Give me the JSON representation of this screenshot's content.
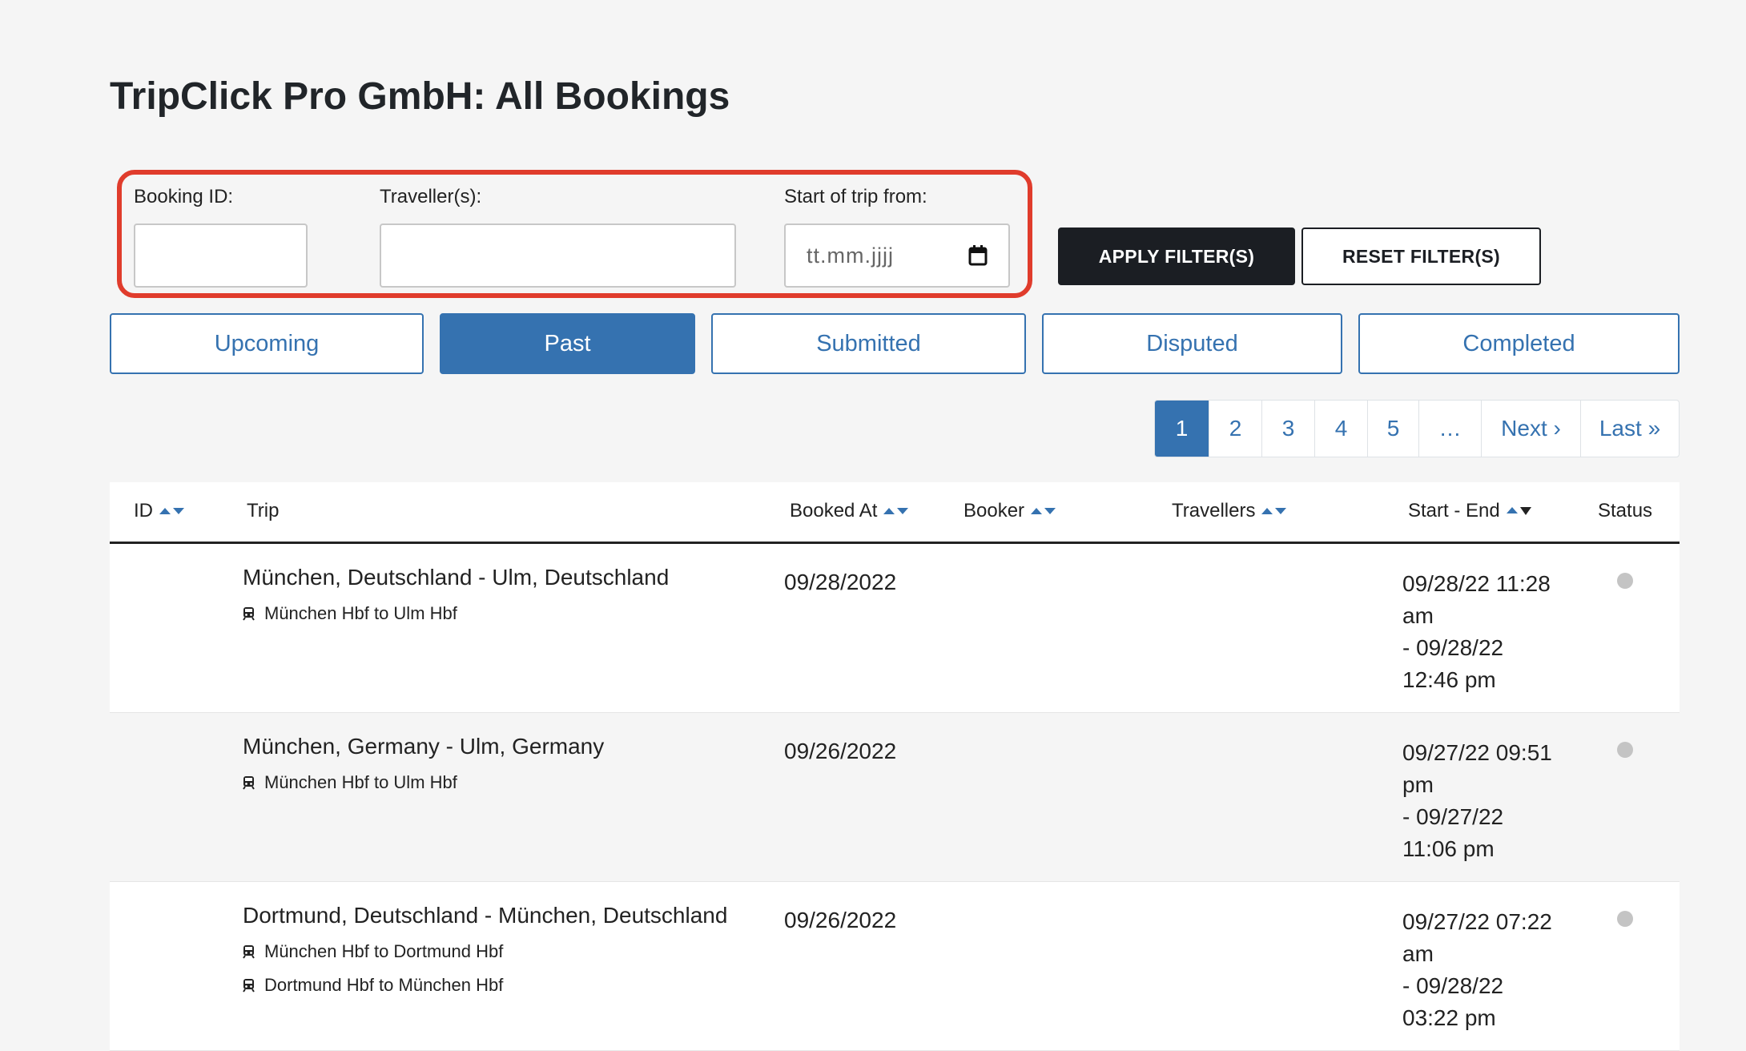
{
  "page": {
    "title": "TripClick Pro GmbH: All Bookings"
  },
  "filters": {
    "booking_id_label": "Booking ID:",
    "travellers_label": "Traveller(s):",
    "start_label": "Start of trip from:",
    "date_placeholder": "tt.mm.jjjj",
    "apply_label": "APPLY FILTER(S)",
    "reset_label": "RESET FILTER(S)"
  },
  "tabs": [
    {
      "label": "Upcoming",
      "active": false
    },
    {
      "label": "Past",
      "active": true
    },
    {
      "label": "Submitted",
      "active": false
    },
    {
      "label": "Disputed",
      "active": false
    },
    {
      "label": "Completed",
      "active": false
    }
  ],
  "pagination": {
    "pages": [
      "1",
      "2",
      "3",
      "4",
      "5",
      "…"
    ],
    "current": "1",
    "next_label": "Next ›",
    "last_label": "Last »"
  },
  "table": {
    "headers": {
      "id": "ID",
      "trip": "Trip",
      "booked_at": "Booked At",
      "booker": "Booker",
      "travellers": "Travellers",
      "start_end": "Start - End",
      "status": "Status"
    },
    "rows": [
      {
        "trip": "München, Deutschland - Ulm, Deutschland",
        "segments": [
          "München Hbf to Ulm Hbf"
        ],
        "booked_at": "09/28/2022",
        "range": [
          "09/28/22 11:28",
          "am",
          "- 09/28/22",
          "12:46 pm"
        ],
        "status_color": "#c4c4c4"
      },
      {
        "trip": "München, Germany - Ulm, Germany",
        "segments": [
          "München Hbf to Ulm Hbf"
        ],
        "booked_at": "09/26/2022",
        "range": [
          "09/27/22 09:51",
          "pm",
          "- 09/27/22",
          "11:06 pm"
        ],
        "status_color": "#c4c4c4"
      },
      {
        "trip": "Dortmund, Deutschland - München, Deutschland",
        "segments": [
          "München Hbf to Dortmund Hbf",
          "Dortmund Hbf to München Hbf"
        ],
        "booked_at": "09/26/2022",
        "range": [
          "09/27/22 07:22",
          "am",
          "- 09/28/22",
          "03:22 pm"
        ],
        "status_color": "#c4c4c4"
      }
    ]
  },
  "colors": {
    "accent": "#3572b0",
    "dark": "#1b1e23",
    "highlight": "#e03c2c"
  }
}
